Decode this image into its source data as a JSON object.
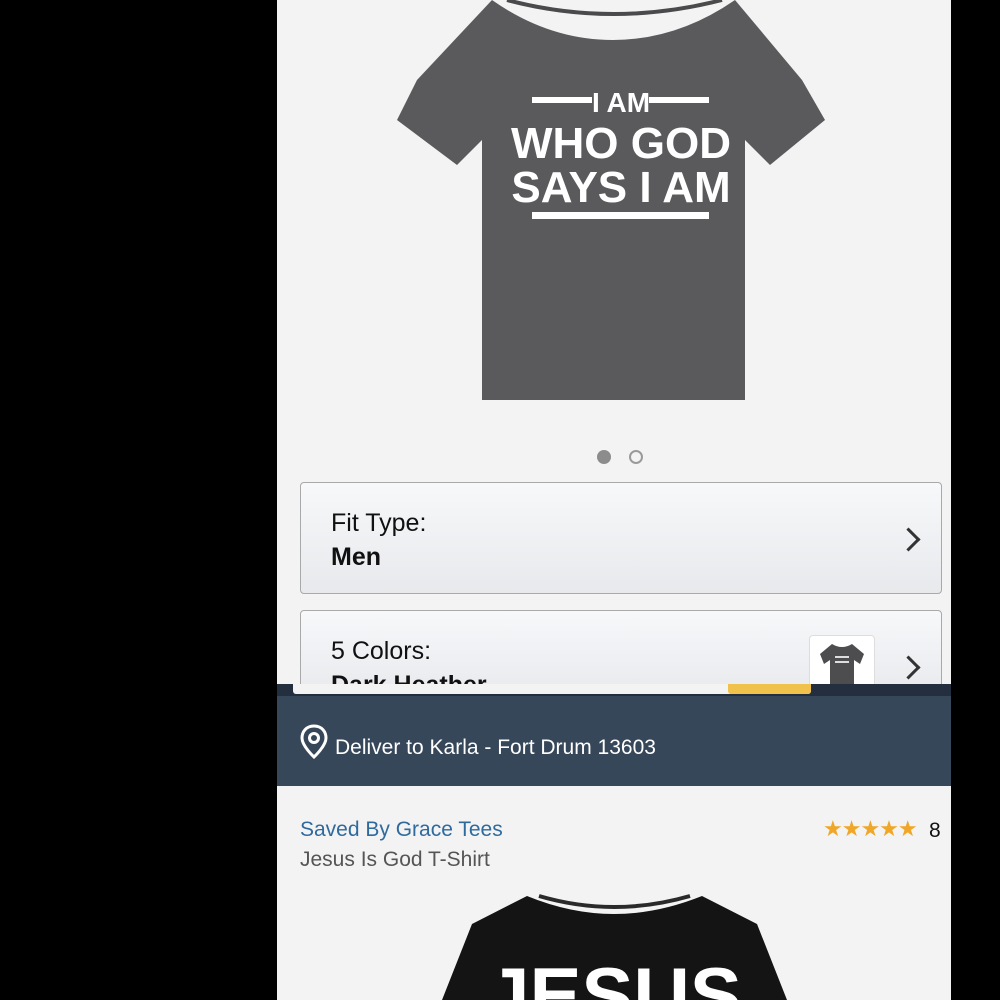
{
  "product_top": {
    "shirt_graphic_text": [
      "I AM",
      "WHO GOD",
      "SAYS I AM"
    ],
    "image_count": 2,
    "active_image_index": 1,
    "fit_type": {
      "label": "Fit Type:",
      "value": "Men"
    },
    "colors": {
      "label": "5 Colors:",
      "value": "Dark Heather"
    }
  },
  "progress": {
    "fraction": 0.16
  },
  "delivery": {
    "text": "Deliver to Karla - Fort Drum 13603",
    "icon": "location-pin-icon"
  },
  "product_bottom": {
    "brand": "Saved By Grace Tees",
    "title": "Jesus Is God T-Shirt",
    "stars": "★★★★★",
    "rating_value": 5,
    "rating_count": "8",
    "shirt_graphic_text": "JESUS"
  },
  "colors": {
    "shirt_gray": "#5a5a5d",
    "shirt_black": "#141414",
    "link_blue": "#2f6a9e",
    "star_orange": "#f0a728",
    "progress_yellow": "#f0c14b",
    "nav_dark": "#37475a"
  }
}
